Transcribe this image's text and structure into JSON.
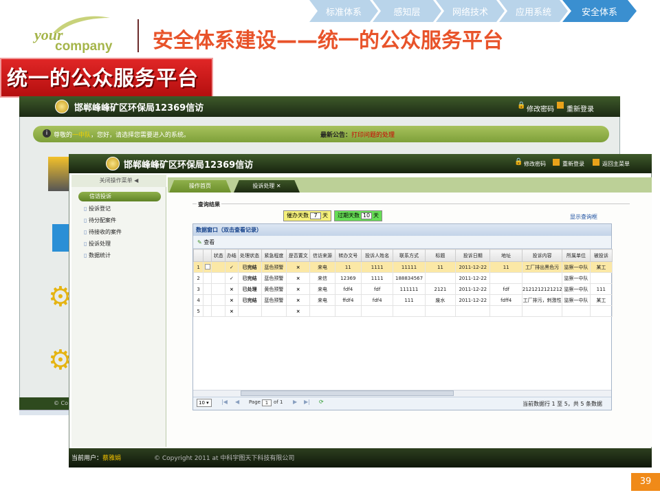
{
  "logo": {
    "line1": "your",
    "line2": "company"
  },
  "page_title": "安全体系建设——统一的公众服务平台",
  "top_nav": [
    {
      "label": "标准体系",
      "active": false
    },
    {
      "label": "感知层",
      "active": false
    },
    {
      "label": "网络技术",
      "active": false
    },
    {
      "label": "应用系统",
      "active": false
    },
    {
      "label": "安全体系",
      "active": true
    }
  ],
  "banner": "统一的公众服务平台",
  "back_window": {
    "title": "邯郸峰峰矿区环保局12369信访",
    "change_password": "修改密码",
    "relogin": "重新登录",
    "greeting_prefix": "尊敬的",
    "greeting_user": "一中队",
    "greeting_suffix": "，您好，请选择您需要进入的系统。",
    "notice_label": "最新公告：",
    "notice_text": "打印问题的处理",
    "footer_text": "© Co"
  },
  "front_window": {
    "title": "邯郸峰峰矿区环保局12369信访",
    "header_links": [
      "修改密码",
      "重新登录",
      "返回主菜单"
    ],
    "sidebar": {
      "close_menu": "关闭操作菜单",
      "group": "信访投诉",
      "items": [
        "投诉登记",
        "待分配案件",
        "待接收的案件",
        "投诉处理",
        "数据统计"
      ]
    },
    "tabs": [
      "操作首页",
      "投诉处理"
    ],
    "query": {
      "legend": "查询结果",
      "due_label": "催办天数",
      "due_value": "7",
      "due_unit": "天",
      "overdue_label": "过期天数",
      "overdue_value": "10",
      "overdue_unit": "天",
      "show_query": "显示查询框"
    },
    "grid": {
      "title": "数据窗口（双击查看记录）",
      "toolbar_view": "查看",
      "columns": [
        "",
        "",
        "状态",
        "办结",
        "处理状态",
        "紧急程度",
        "是否置文",
        "信访来源",
        "转办文号",
        "投诉人姓名",
        "联系方式",
        "标题",
        "投诉日期",
        "地址",
        "投诉内容",
        "所属单位",
        "被投诉"
      ],
      "rows": [
        {
          "no": "1",
          "done": "✓",
          "status": "已完结",
          "urgency": "蓝色预警",
          "doc": "×",
          "source": "来电",
          "ref": "11",
          "name": "1111",
          "contact": "11111",
          "title": "11",
          "date": "2011-12-22",
          "addr": "11",
          "content": "工厂排出黑色污",
          "unit": "监察一中队",
          "target": "某工"
        },
        {
          "no": "2",
          "done": "✓",
          "status": "已完结",
          "urgency": "蓝色预警",
          "doc": "×",
          "source": "来信",
          "ref": "12369",
          "name": "1111",
          "contact": "188834567",
          "title": "",
          "date": "2011-12-22",
          "addr": "",
          "content": "",
          "unit": "监察一中队",
          "target": ""
        },
        {
          "no": "3",
          "done": "×",
          "status": "已处理",
          "urgency": "黄色预警",
          "doc": "×",
          "source": "来电",
          "ref": "fdf4",
          "name": "fdf",
          "contact": "111111",
          "title": "2121",
          "date": "2011-12-22",
          "addr": "fdf",
          "content": "21212121212121",
          "unit": "监察一中队",
          "target": "111"
        },
        {
          "no": "4",
          "done": "×",
          "status": "已完结",
          "urgency": "蓝色预警",
          "doc": "×",
          "source": "来电",
          "ref": "ffdf4",
          "name": "fdf4",
          "contact": "111",
          "title": "废水",
          "date": "2011-12-22",
          "addr": "fdff4",
          "content": "工厂排污，刺激性",
          "unit": "监察一中队",
          "target": "某工"
        },
        {
          "no": "5",
          "done": "×",
          "status": "",
          "urgency": "",
          "doc": "×",
          "source": "",
          "ref": "",
          "name": "",
          "contact": "",
          "title": "",
          "date": "",
          "addr": "",
          "content": "",
          "unit": "",
          "target": ""
        }
      ],
      "pager": {
        "page_size": "10",
        "page_label": "Page",
        "page_value": "1",
        "of_label": "of 1",
        "info": "当前数据行 1 至 5，共 5 条数据"
      }
    },
    "footer": {
      "user_label": "当前用户：",
      "user_name": "蔡雅娟",
      "copyright": "© Copyright 2011 at 中科宇图天下科技有限公司"
    }
  },
  "slide_number": "39"
}
